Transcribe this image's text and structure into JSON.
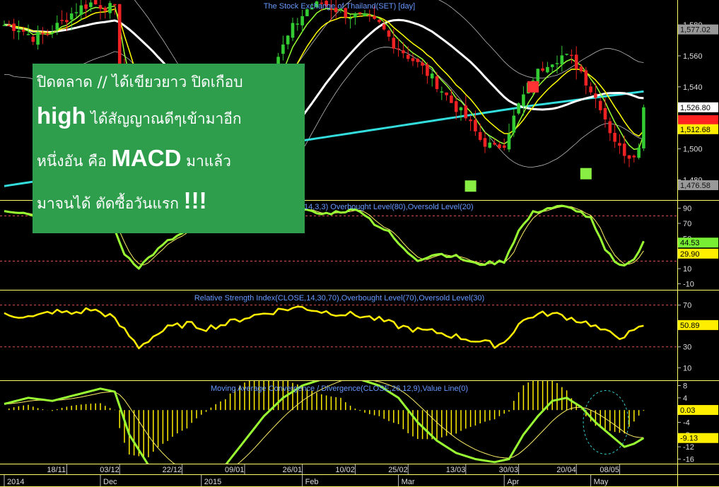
{
  "chart_title": "The Stock Exchange of Thailand(SET) [day]",
  "note": {
    "line1": "ปิดตลาด // ได้เขียวยาว ปิดเกือบ",
    "line2_big": "high",
    "line2": " ได้สัญญาณดีๆเข้ามาอีก",
    "line3": "หนึ่งอัน คือ ",
    "line3_big": "MACD",
    "line3_end": " มาแล้ว",
    "line4": "มาจนได้ ตัดซื้อวันแรก ",
    "line4_big": "!!!"
  },
  "colors": {
    "background": "#000000",
    "panel_border": "#ffff66",
    "bull_candle": "#33cc33",
    "bear_candle": "#ee2222",
    "ema_fast": "#99ff33",
    "ema_slow": "#ffff00",
    "ma_mid": "#ffffff",
    "ma_long": "#33dddd",
    "band": "#bbbbbb",
    "signal_box_buy": "#88ee44",
    "signal_box_sell": "#ff3333",
    "note_bg": "#2e9e4c",
    "label_text": "#6699ff"
  },
  "chart_data": [
    {
      "type": "candlestick",
      "title": "The Stock Exchange of Thailand(SET) [day]",
      "y_ticks": [
        1480,
        1500,
        1520,
        1540,
        1560,
        1580
      ],
      "ylim": [
        1467,
        1596
      ],
      "price_labels": [
        {
          "value": 1577.02,
          "text": "1,577.02",
          "style": "gray"
        },
        {
          "value": 1526.8,
          "text": "1,526.80",
          "style": "white"
        },
        {
          "value": 1518.5,
          "text": "",
          "style": "red"
        },
        {
          "value": 1512.68,
          "text": "1,512.68",
          "style": "yellow"
        },
        {
          "value": 1476.58,
          "text": "1,476.58",
          "style": "gray"
        }
      ],
      "signal_boxes": [
        {
          "index": 97,
          "value": 1476,
          "type": "buy"
        },
        {
          "index": 110,
          "value": 1540,
          "type": "sell"
        },
        {
          "index": 121,
          "value": 1484,
          "type": "buy"
        }
      ]
    },
    {
      "type": "line",
      "title": "Stochastic(14,3,3) Overbought Level(80),Oversold Level(20)",
      "title_visible": "14,3,3) Overbought Level(80),Oversold Level(20)",
      "y_ticks": [
        -10,
        10,
        30,
        50,
        70,
        90
      ],
      "ylim": [
        -18,
        100
      ],
      "levels": [
        80,
        20
      ],
      "last_values": [
        {
          "text": "44.53",
          "value": 44.53,
          "style": "green"
        },
        {
          "text": "29.90",
          "value": 29.9,
          "style": "yellow"
        }
      ]
    },
    {
      "type": "line",
      "title": "Relative Strength Index(CLOSE,14,30,70),Overbought Level(70),Oversold Level(30)",
      "y_ticks": [
        10,
        30,
        50,
        70
      ],
      "ylim": [
        -2,
        84
      ],
      "levels": [
        70,
        30
      ],
      "last_values": [
        {
          "text": "50.89",
          "value": 50.89,
          "style": "yellow"
        }
      ]
    },
    {
      "type": "bar+line",
      "title": "Moving Average Convergence / Divergence(CLOSE,26,12,9),Value Line(0)",
      "y_ticks": [
        -16,
        -12,
        -8,
        -4,
        0,
        4,
        8
      ],
      "ylim": [
        -17.5,
        9.5
      ],
      "last_values": [
        {
          "text": "0.03",
          "value": 0.03,
          "style": "yellow"
        },
        {
          "text": "-9.13",
          "value": -9.13,
          "style": "yellow"
        }
      ],
      "highlight_ellipse_index": 120
    }
  ],
  "x_axis": {
    "top_labels": [
      {
        "text": "18/11",
        "index": 13
      },
      {
        "text": "03/12",
        "index": 24
      },
      {
        "text": "22/12",
        "index": 37
      },
      {
        "text": "09/01",
        "index": 50
      },
      {
        "text": "26/01",
        "index": 62
      },
      {
        "text": "10/02",
        "index": 73
      },
      {
        "text": "25/02",
        "index": 84
      },
      {
        "text": "13/03",
        "index": 96
      },
      {
        "text": "30/03",
        "index": 107
      },
      {
        "text": "20/04",
        "index": 119
      },
      {
        "text": "08/05",
        "index": 128
      }
    ],
    "bottom_labels": [
      {
        "text": "2014",
        "index": 0
      },
      {
        "text": "Dec",
        "index": 20
      },
      {
        "text": "2015",
        "index": 41
      },
      {
        "text": "Feb",
        "index": 62
      },
      {
        "text": "Mar",
        "index": 82
      },
      {
        "text": "Apr",
        "index": 104
      },
      {
        "text": "May",
        "index": 122
      }
    ]
  }
}
